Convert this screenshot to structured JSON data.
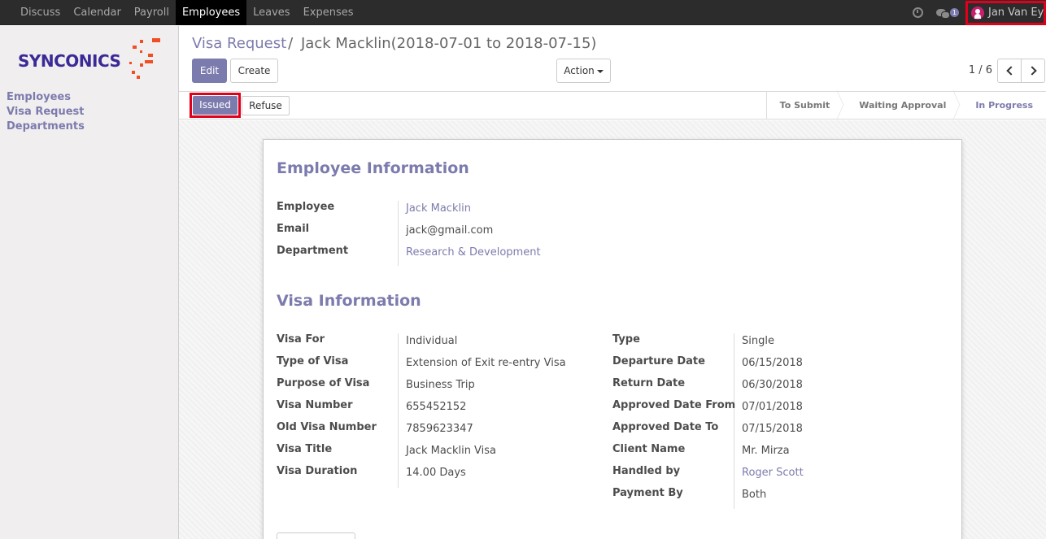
{
  "topmenu": [
    {
      "label": "Discuss",
      "active": false
    },
    {
      "label": "Calendar",
      "active": false
    },
    {
      "label": "Payroll",
      "active": false
    },
    {
      "label": "Employees",
      "active": true
    },
    {
      "label": "Leaves",
      "active": false
    },
    {
      "label": "Expenses",
      "active": false
    }
  ],
  "topright": {
    "message_count": "1",
    "user_name": "Jan Van Eyck"
  },
  "logo": {
    "text": "SYNCONICS"
  },
  "sidebar": {
    "items": [
      "Employees",
      "Visa Request",
      "Departments"
    ]
  },
  "breadcrumb": {
    "parent": "Visa Request",
    "separator": "/",
    "current": "Jack Macklin(2018-07-01 to 2018-07-15)"
  },
  "buttons": {
    "edit": "Edit",
    "create": "Create",
    "action": "Action"
  },
  "pager": {
    "value": "1 / 6"
  },
  "statusbar": {
    "issued": "Issued",
    "refuse": "Refuse",
    "stages": [
      {
        "label": "To Submit",
        "current": false
      },
      {
        "label": "Waiting Approval",
        "current": false
      },
      {
        "label": "In Progress",
        "current": true
      }
    ]
  },
  "employee_info": {
    "title": "Employee Information",
    "fields": [
      {
        "label": "Employee",
        "value": "Jack Macklin",
        "link": true
      },
      {
        "label": "Email",
        "value": "jack@gmail.com",
        "link": false
      },
      {
        "label": "Department",
        "value": "Research & Development",
        "link": true
      }
    ]
  },
  "visa_info": {
    "title": "Visa Information",
    "left_fields": [
      {
        "label": "Visa For",
        "value": "Individual",
        "link": false
      },
      {
        "label": "Type of Visa",
        "value": "Extension of Exit re-entry Visa",
        "link": false
      },
      {
        "label": "Purpose of Visa",
        "value": "Business Trip",
        "link": false
      },
      {
        "label": "Visa Number",
        "value": "655452152",
        "link": false
      },
      {
        "label": "Old Visa Number",
        "value": "7859623347",
        "link": false
      },
      {
        "label": "Visa Title",
        "value": "Jack Macklin Visa",
        "link": false
      },
      {
        "label": "Visa Duration",
        "value": "14.00 Days",
        "link": false
      }
    ],
    "right_fields": [
      {
        "label": "Type",
        "value": "Single",
        "link": false
      },
      {
        "label": "Departure Date",
        "value": "06/15/2018",
        "link": false
      },
      {
        "label": "Return Date",
        "value": "06/30/2018",
        "link": false
      },
      {
        "label": "Approved Date From",
        "value": "07/01/2018",
        "link": false
      },
      {
        "label": "Approved Date To",
        "value": "07/15/2018",
        "link": false
      },
      {
        "label": "Client Name",
        "value": "Mr. Mirza",
        "link": false
      },
      {
        "label": "Handled by",
        "value": "Roger Scott",
        "link": true
      },
      {
        "label": "Payment By",
        "value": "Both",
        "link": false
      }
    ]
  },
  "colors": {
    "brand": "#7c7bad",
    "topbar": "#2c2c2c",
    "highlight": "#e0001b",
    "logo_text": "#3b2a96",
    "logo_spark": "#f04e23"
  }
}
